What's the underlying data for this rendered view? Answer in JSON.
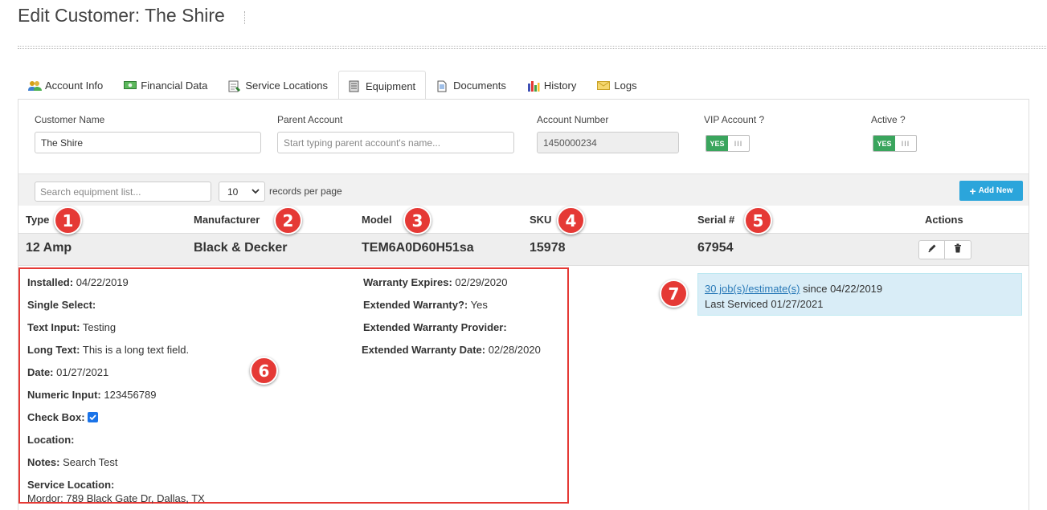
{
  "page": {
    "title": "Edit Customer: The Shire"
  },
  "tabs": [
    {
      "label": "Account Info",
      "icon": "users-icon"
    },
    {
      "label": "Financial Data",
      "icon": "money-icon"
    },
    {
      "label": "Service Locations",
      "icon": "map-icon"
    },
    {
      "label": "Equipment",
      "icon": "server-icon",
      "active": true
    },
    {
      "label": "Documents",
      "icon": "document-icon"
    },
    {
      "label": "History",
      "icon": "bar-chart-icon"
    },
    {
      "label": "Logs",
      "icon": "envelope-icon"
    }
  ],
  "form": {
    "customer_name": {
      "label": "Customer Name",
      "value": "The Shire"
    },
    "parent_account": {
      "label": "Parent Account",
      "placeholder": "Start typing parent account's name..."
    },
    "account_number": {
      "label": "Account Number",
      "value": "1450000234"
    },
    "vip_account": {
      "label": "VIP Account ?",
      "state": "YES",
      "knob": "III"
    },
    "active": {
      "label": "Active ?",
      "state": "YES",
      "knob": "III"
    }
  },
  "toolbar": {
    "search_placeholder": "Search equipment list...",
    "records_per_page_value": "10",
    "records_per_page_label": "records per page",
    "add_new_label": "Add New"
  },
  "table": {
    "headers": [
      "Type",
      "Manufacturer",
      "Model",
      "SKU",
      "Serial #",
      "Actions"
    ],
    "row": {
      "type": "12 Amp",
      "manufacturer": "Black & Decker",
      "model": "TEM6A0D60H51sa",
      "sku": "15978",
      "serial": "67954"
    }
  },
  "details": {
    "left": [
      {
        "label": "Installed:",
        "value": "04/22/2019"
      },
      {
        "label": "Single Select:",
        "value": ""
      },
      {
        "label": "Text Input:",
        "value": "Testing"
      },
      {
        "label": "Long Text:",
        "value": "This is a long text field."
      },
      {
        "label": "Date:",
        "value": "01/27/2021"
      },
      {
        "label": "Numeric Input:",
        "value": "123456789"
      },
      {
        "label": "Check Box:",
        "value": ""
      },
      {
        "label": "Location:",
        "value": ""
      },
      {
        "label": "Notes:",
        "value": "Search Test"
      },
      {
        "label": "Service Location:",
        "value": "Mordor: 789 Black Gate Dr, Dallas, TX"
      }
    ],
    "right": [
      {
        "label": "Warranty Expires:",
        "value": "02/29/2020"
      },
      {
        "label": "Extended Warranty?:",
        "value": "Yes"
      },
      {
        "label": "Extended Warranty Provider:",
        "value": ""
      },
      {
        "label": "Extended Warranty Date:",
        "value": "02/28/2020"
      }
    ],
    "checkbox_checked": true
  },
  "service_info": {
    "link": "30 job(s)/estimate(s)",
    "since": "since 04/22/2019",
    "last_serviced": "Last Serviced 01/27/2021"
  },
  "markers": [
    "1",
    "2",
    "3",
    "4",
    "5",
    "6",
    "7"
  ],
  "colors": {
    "accent": "#2ba5db",
    "toggle_on": "#3aa55d",
    "marker": "#e53935",
    "info_bg": "#d9edf7"
  }
}
